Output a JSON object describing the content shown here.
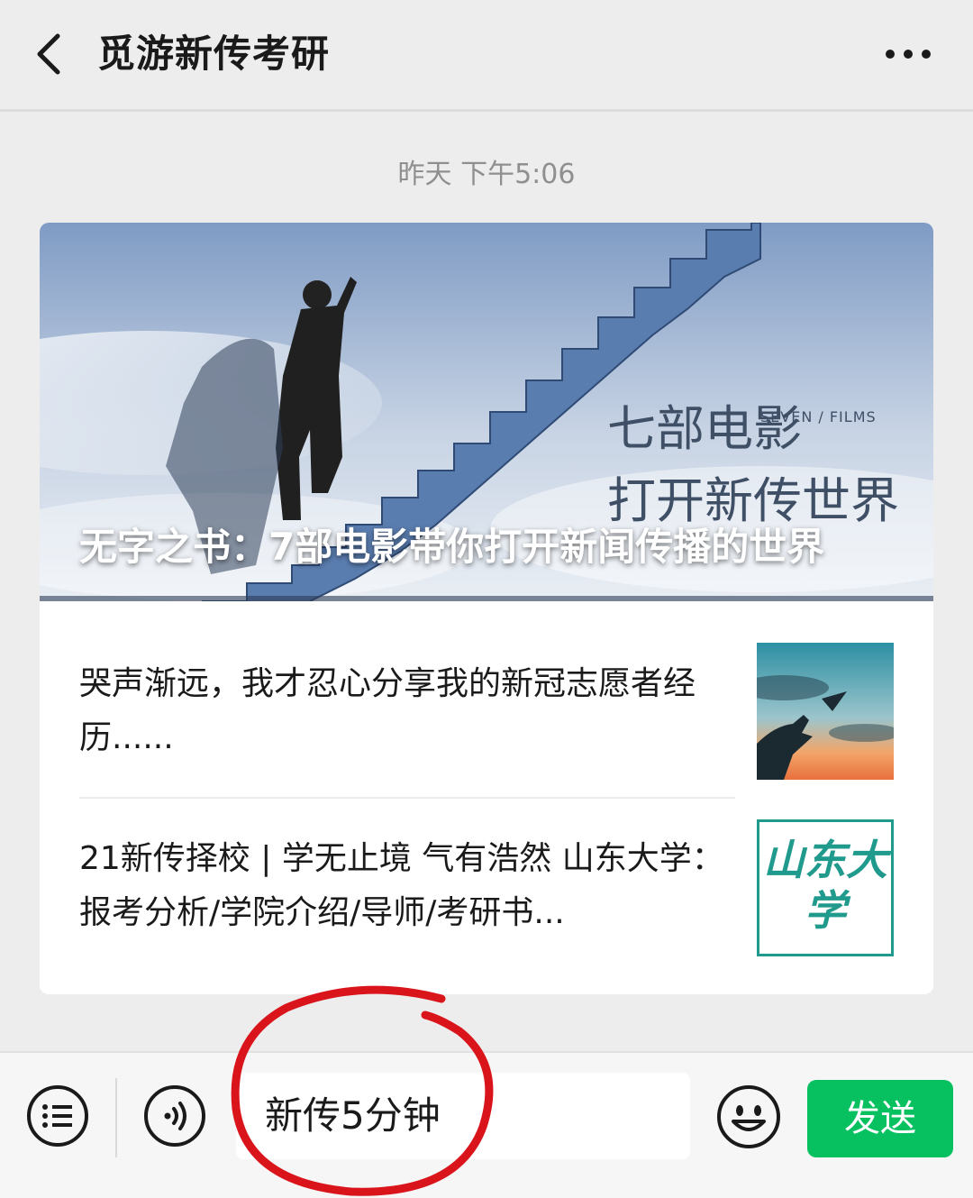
{
  "header": {
    "title": "觅游新传考研",
    "back_icon": "chevron-left-icon",
    "more_icon": "more-dots-icon"
  },
  "timestamp": "昨天 下午5:06",
  "card": {
    "banner": {
      "title": "无字之书：7部电影带你打开新闻传播的世界",
      "overlay_line1": "七部电影",
      "overlay_en": "SEVEN / FILMS",
      "overlay_line2": "打开新传世界"
    },
    "items": [
      {
        "text": "哭声渐远，我才忍心分享我的新冠志愿者经历......"
      },
      {
        "text": "21新传择校 | 学无止境 气有浩然 山东大学：报考分析/学院介绍/导师/考研书...",
        "thumb_text": "山东大学"
      }
    ]
  },
  "bottombar": {
    "input_value": "新传5分钟",
    "send_label": "发送",
    "menu_icon": "menu-list-icon",
    "voice_icon": "voice-icon",
    "emoji_icon": "emoji-icon"
  },
  "colors": {
    "send_green": "#07c160",
    "annotation_red": "#d9141b",
    "shandong_teal": "#1f9a8c"
  }
}
